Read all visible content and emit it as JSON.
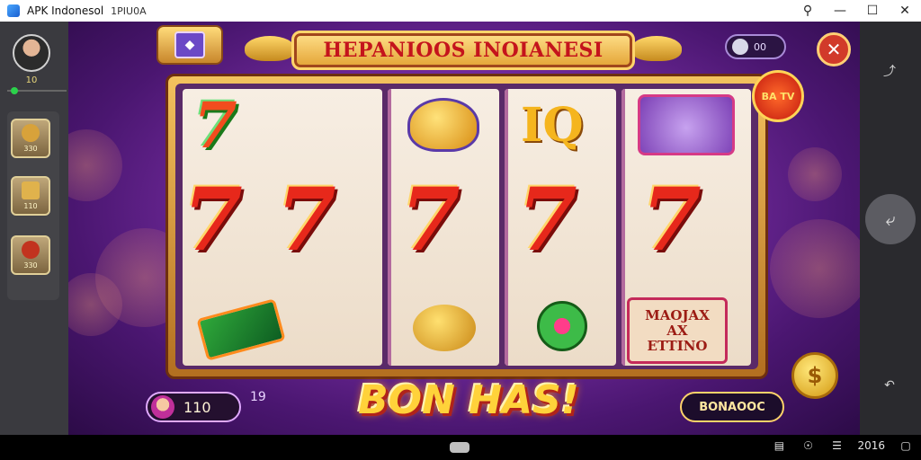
{
  "window": {
    "title": "APK Indonesol",
    "subtitle": "1PIU0A",
    "buttons": [
      "search-icon",
      "minimize-icon",
      "maximize-icon",
      "close-icon"
    ]
  },
  "sidebar": {
    "level": "10",
    "tiles": [
      {
        "icon": "coin-stack-icon",
        "label": "330"
      },
      {
        "icon": "gift-box-icon",
        "label": "110"
      },
      {
        "icon": "chest-icon",
        "label": "330"
      }
    ]
  },
  "header": {
    "banner": "HEPANIOOS INOIANESI",
    "pill_value": "00"
  },
  "reels": {
    "bonus_tile": [
      "MAOJAX",
      "AX",
      "ETTINO"
    ],
    "badge_text": "BA TV"
  },
  "footer": {
    "big_text": "BON HAS!",
    "balance": "110",
    "side_number": "19",
    "bonus_button": "BONAOOC"
  },
  "system_bar": {
    "clock": "2016"
  }
}
